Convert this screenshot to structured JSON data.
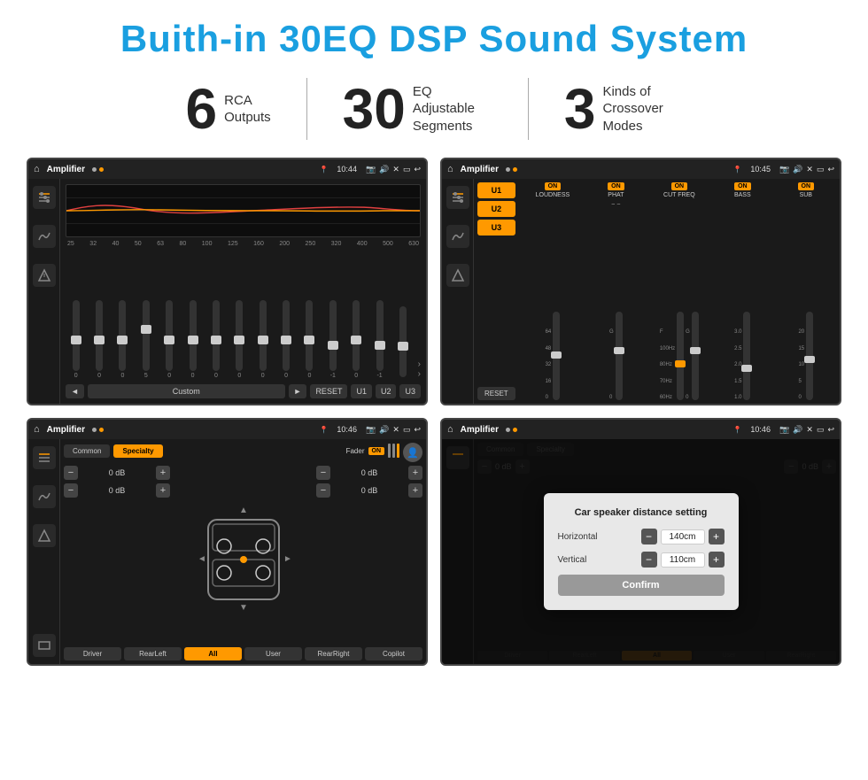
{
  "header": {
    "title": "Buith-in 30EQ DSP Sound System"
  },
  "stats": [
    {
      "number": "6",
      "label": "RCA\nOutputs"
    },
    {
      "number": "30",
      "label": "EQ Adjustable\nSegments"
    },
    {
      "number": "3",
      "label": "Kinds of\nCrossover Modes"
    }
  ],
  "screens": [
    {
      "id": "screen1",
      "status": {
        "title": "Amplifier",
        "time": "10:44"
      },
      "type": "eq"
    },
    {
      "id": "screen2",
      "status": {
        "title": "Amplifier",
        "time": "10:45"
      },
      "type": "amp"
    },
    {
      "id": "screen3",
      "status": {
        "title": "Amplifier",
        "time": "10:46"
      },
      "type": "speaker"
    },
    {
      "id": "screen4",
      "status": {
        "title": "Amplifier",
        "time": "10:46"
      },
      "type": "dialog"
    }
  ],
  "eq": {
    "freqs": [
      "25",
      "32",
      "40",
      "50",
      "63",
      "80",
      "100",
      "125",
      "160",
      "200",
      "250",
      "320",
      "400",
      "500",
      "630"
    ],
    "values": [
      "0",
      "0",
      "0",
      "5",
      "0",
      "0",
      "0",
      "0",
      "0",
      "0",
      "0",
      "-1",
      "0",
      "-1",
      ""
    ],
    "presets": [
      "Custom",
      "RESET",
      "U1",
      "U2",
      "U3"
    ]
  },
  "amp": {
    "u_buttons": [
      "U1",
      "U2",
      "U3"
    ],
    "columns": [
      {
        "label": "LOUDNESS",
        "on": true
      },
      {
        "label": "PHAT",
        "on": true
      },
      {
        "label": "CUT FREQ",
        "on": true
      },
      {
        "label": "BASS",
        "on": true
      },
      {
        "label": "SUB",
        "on": true
      }
    ],
    "reset": "RESET"
  },
  "speaker": {
    "tabs": [
      "Common",
      "Specialty"
    ],
    "active_tab": "Specialty",
    "fader_label": "Fader",
    "fader_on": "ON",
    "db_values": [
      "0 dB",
      "0 dB",
      "0 dB",
      "0 dB"
    ],
    "positions": [
      "Driver",
      "RearLeft",
      "All",
      "User",
      "RearRight",
      "Copilot"
    ]
  },
  "dialog": {
    "title": "Car speaker distance setting",
    "fields": [
      {
        "label": "Horizontal",
        "value": "140cm"
      },
      {
        "label": "Vertical",
        "value": "110cm"
      }
    ],
    "confirm_label": "Confirm"
  }
}
